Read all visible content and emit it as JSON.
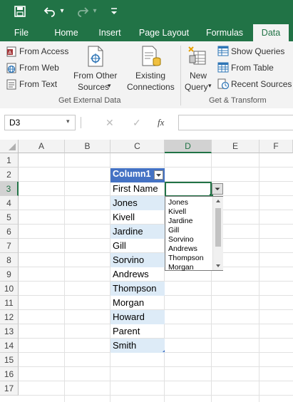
{
  "quick_access": {
    "save_icon": "save-icon",
    "undo_icon": "undo-icon",
    "redo_icon": "redo-icon",
    "customize_icon": "customize-qat-icon"
  },
  "tabs": [
    "File",
    "Home",
    "Insert",
    "Page Layout",
    "Formulas",
    "Data"
  ],
  "active_tab": "Data",
  "ribbon": {
    "get_external_data": {
      "from_access": "From Access",
      "from_web": "From Web",
      "from_text": "From Text",
      "from_other_sources_1": "From Other",
      "from_other_sources_2": "Sources",
      "existing_connections_1": "Existing",
      "existing_connections_2": "Connections",
      "label": "Get External Data"
    },
    "get_transform": {
      "new_query_1": "New",
      "new_query_2": "Query",
      "show_queries": "Show Queries",
      "from_table": "From Table",
      "recent_sources": "Recent Sources",
      "label": "Get & Transform"
    },
    "dropdown_glyph": "▾"
  },
  "formula_bar": {
    "name_box": "D3",
    "cancel_glyph": "✕",
    "enter_glyph": "✓",
    "fx_glyph": "fx",
    "value": ""
  },
  "columns": [
    "A",
    "B",
    "C",
    "D",
    "E",
    "F"
  ],
  "rows": [
    "1",
    "2",
    "3",
    "4",
    "5",
    "6",
    "7",
    "8",
    "9",
    "10",
    "11",
    "12",
    "13",
    "14",
    "15",
    "16",
    "17"
  ],
  "table": {
    "header": "Column1",
    "values": [
      "First Name",
      "Jones",
      "Kivell",
      "Jardine",
      "Gill",
      "Sorvino",
      "Andrews",
      "Thompson",
      "Morgan",
      "Howard",
      "Parent",
      "Smith"
    ]
  },
  "validation_dropdown": {
    "items": [
      "Jones",
      "Kivell",
      "Jardine",
      "Gill",
      "Sorvino",
      "Andrews",
      "Thompson",
      "Morgan"
    ]
  },
  "colors": {
    "excel_green": "#217346",
    "band": "#ddebf7",
    "header_fill": "#4472c4"
  }
}
